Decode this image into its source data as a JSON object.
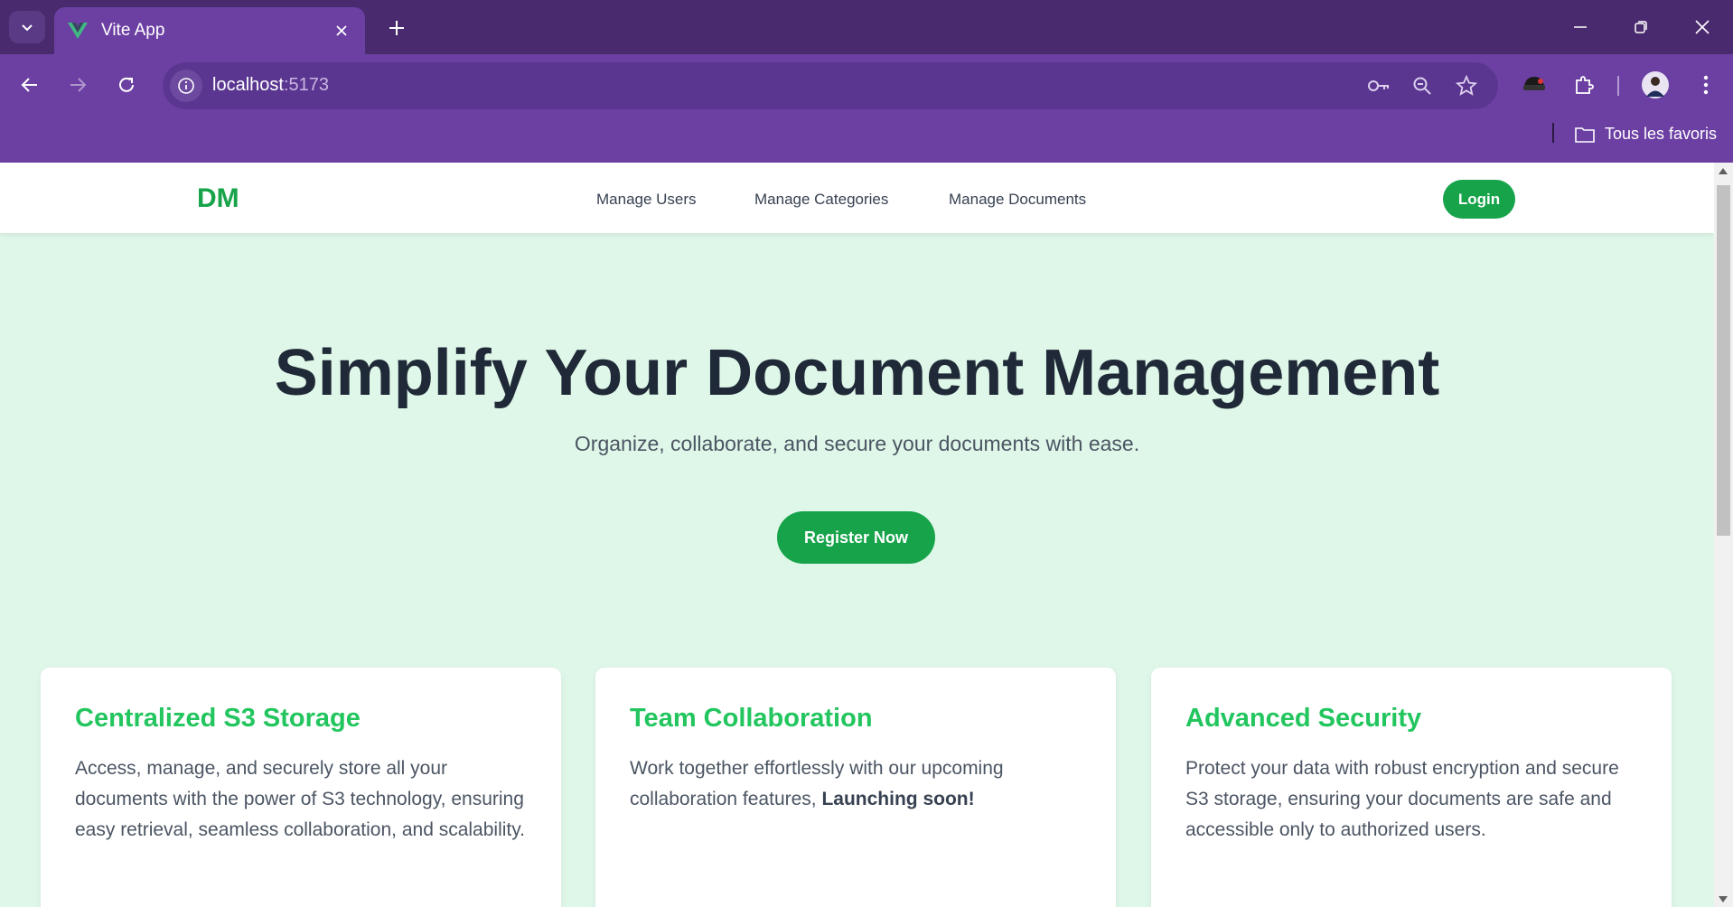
{
  "browser": {
    "tab": {
      "title": "Vite App"
    },
    "address": {
      "host": "localhost",
      "port": ":5173"
    },
    "bookmarks": {
      "folder_label": "Tous les favoris"
    }
  },
  "colors": {
    "brand_green": "#16a34a",
    "card_title_green": "#22c55e",
    "page_background": "#dff7e8",
    "browser_frame": "#6c40a3"
  },
  "navbar": {
    "logo": "DM",
    "links": [
      "Manage Users",
      "Manage Categories",
      "Manage Documents"
    ],
    "login_label": "Login"
  },
  "hero": {
    "title": "Simplify Your Document Management",
    "subtitle": "Organize, collaborate, and secure your documents with ease.",
    "cta_label": "Register Now"
  },
  "features": [
    {
      "title": "Centralized S3 Storage",
      "text": "Access, manage, and securely store all your documents with the power of S3 technology, ensuring easy retrieval, seamless collaboration, and scalability."
    },
    {
      "title": "Team Collaboration",
      "text": "Work together effortlessly with our upcoming collaboration features, ",
      "emphasis": "Launching soon!"
    },
    {
      "title": "Advanced Security",
      "text": "Protect your data with robust encryption and secure S3 storage, ensuring your documents are safe and accessible only to authorized users."
    }
  ],
  "icons": [
    "tab-search-icon",
    "vue-logo-icon",
    "close-icon",
    "plus-icon",
    "minimize-icon",
    "restore-icon",
    "back-icon",
    "forward-icon",
    "reload-icon",
    "site-info-icon",
    "key-icon",
    "zoom-icon",
    "star-icon",
    "extension-icon",
    "puzzle-icon",
    "avatar",
    "kebab-menu-icon",
    "folder-icon"
  ]
}
